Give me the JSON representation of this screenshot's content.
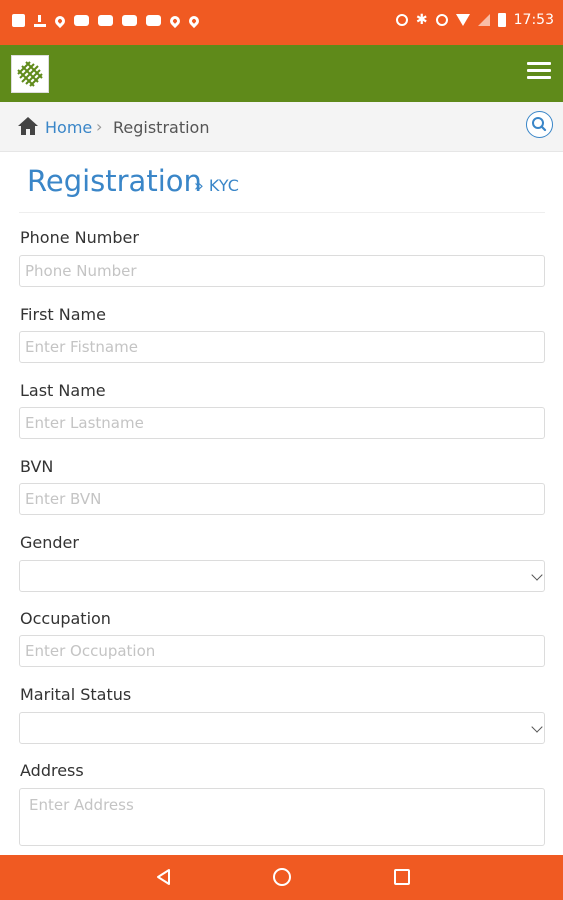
{
  "status_bar": {
    "time": "17:53",
    "left_icons": [
      "image-icon",
      "download-icon",
      "location-icon",
      "youtube-icon",
      "youtube-icon",
      "youtube-icon",
      "youtube-icon",
      "location-icon",
      "location-icon"
    ],
    "right_icons": [
      "data-saver-icon",
      "bluetooth-icon",
      "alarm-icon",
      "wifi-icon",
      "signal-icon",
      "battery-icon"
    ]
  },
  "colors": {
    "status_bar": "#f05a22",
    "app_bar": "#5f8a1a",
    "accent": "#3a86c8",
    "nav_bar": "#f05a22"
  },
  "app_bar": {
    "logo_icon": "app-logo-icon",
    "menu_icon": "hamburger-menu-icon"
  },
  "breadcrumb": {
    "home_label": "Home",
    "separator": "›",
    "current": "Registration",
    "home_icon": "home-icon",
    "search_icon": "search-icon"
  },
  "page": {
    "title": "Registration",
    "subtitle": "» KYC"
  },
  "form": {
    "phone": {
      "label": "Phone Number",
      "placeholder": "Phone Number"
    },
    "first_name": {
      "label": "First Name",
      "placeholder": "Enter Fistname"
    },
    "last_name": {
      "label": "Last Name",
      "placeholder": "Enter Lastname"
    },
    "bvn": {
      "label": "BVN",
      "placeholder": "Enter BVN"
    },
    "gender": {
      "label": "Gender",
      "value": ""
    },
    "occupation": {
      "label": "Occupation",
      "placeholder": "Enter Occupation"
    },
    "marital_status": {
      "label": "Marital Status",
      "value": ""
    },
    "address": {
      "label": "Address",
      "placeholder": "Enter Address"
    }
  },
  "nav_bar": {
    "icons": [
      "back-icon",
      "home-circle-icon",
      "recents-icon"
    ]
  }
}
